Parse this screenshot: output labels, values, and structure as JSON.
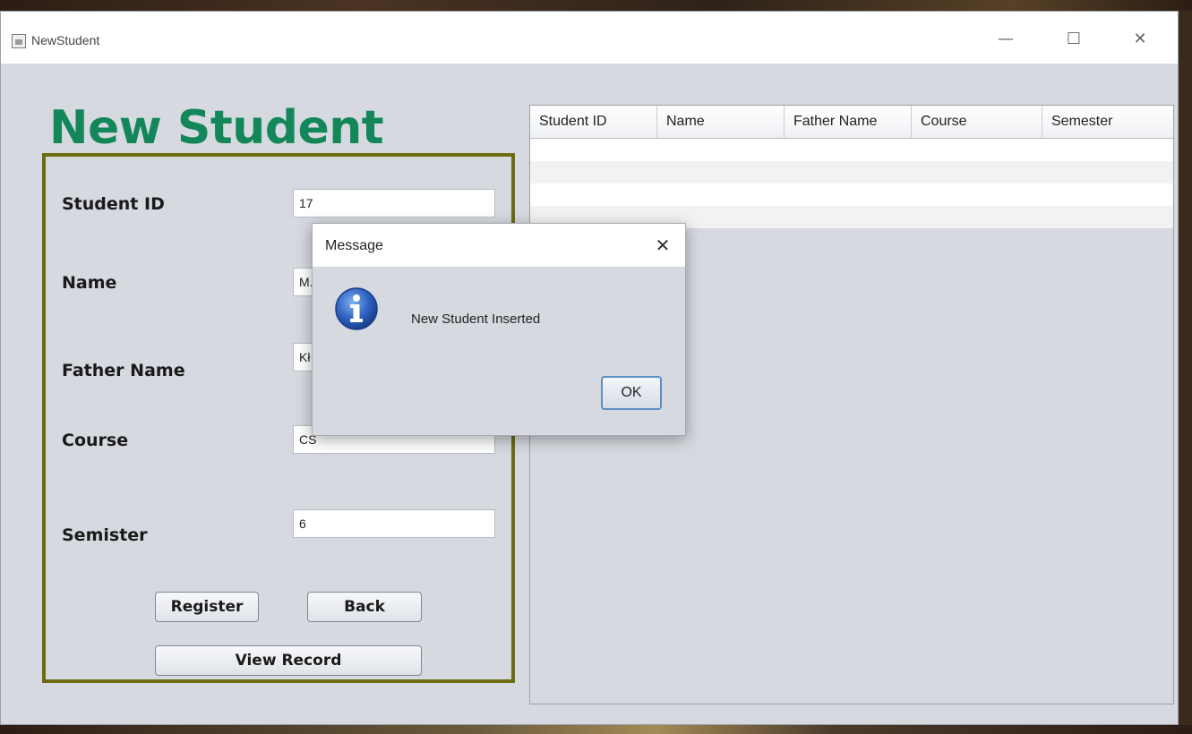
{
  "window": {
    "title": "NewStudent",
    "controls": {
      "minimize": "—",
      "maximize": "☐",
      "close": "✕"
    }
  },
  "heading": "New Student",
  "form": {
    "fields": [
      {
        "label": "Student ID",
        "value": "17"
      },
      {
        "label": "Name",
        "value": "M."
      },
      {
        "label": "Father Name",
        "value": "Kł"
      },
      {
        "label": "Course",
        "value": "CS"
      },
      {
        "label": "Semister",
        "value": "6"
      }
    ],
    "buttons": {
      "register": "Register",
      "back": "Back",
      "view_record": "View Record"
    }
  },
  "table": {
    "columns": [
      "Student ID",
      "Name",
      "Father Name",
      "Course",
      "Semester"
    ],
    "rows": []
  },
  "dialog": {
    "title": "Message",
    "close": "✕",
    "message": "New Student Inserted",
    "icon": "info-icon",
    "ok": "OK"
  },
  "colors": {
    "heading": "#14875a",
    "panel_border": "#6d6d10",
    "info_icon": "#2f63c2"
  }
}
